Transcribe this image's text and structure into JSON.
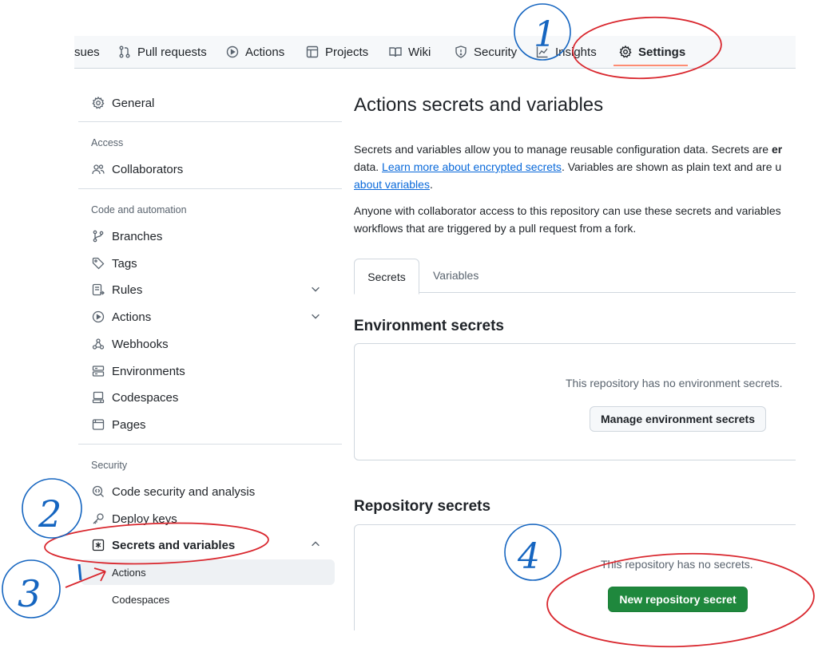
{
  "topnav": {
    "items": [
      {
        "label": "sues"
      },
      {
        "label": "Pull requests"
      },
      {
        "label": "Actions"
      },
      {
        "label": "Projects"
      },
      {
        "label": "Wiki"
      },
      {
        "label": "Security"
      },
      {
        "label": "Insights"
      },
      {
        "label": "Settings"
      }
    ]
  },
  "sidebar": {
    "general": "General",
    "access_heading": "Access",
    "collaborators": "Collaborators",
    "code_heading": "Code and automation",
    "branches": "Branches",
    "tags": "Tags",
    "rules": "Rules",
    "actions": "Actions",
    "webhooks": "Webhooks",
    "environments": "Environments",
    "codespaces": "Codespaces",
    "pages": "Pages",
    "security_heading": "Security",
    "code_security": "Code security and analysis",
    "deploy_keys": "Deploy keys",
    "secrets_vars": "Secrets and variables",
    "sub_actions": "Actions",
    "sub_codespaces": "Codespaces"
  },
  "main": {
    "title": "Actions secrets and variables",
    "desc1_a": "Secrets and variables allow you to manage reusable configuration data. Secrets are ",
    "desc1_b": "er",
    "desc2_a": "data. ",
    "desc2_link": "Learn more about encrypted secrets",
    "desc2_b": ". Variables are shown as plain text and are u",
    "desc3_link": "about variables",
    "desc3_b": ".",
    "desc4": "Anyone with collaborator access to this repository can use these secrets and variables",
    "desc5": "workflows that are triggered by a pull request from a fork.",
    "tabs": [
      {
        "label": "Secrets"
      },
      {
        "label": "Variables"
      }
    ],
    "env_heading": "Environment secrets",
    "env_empty": "This repository has no environment secrets.",
    "env_button": "Manage environment secrets",
    "repo_heading": "Repository secrets",
    "repo_empty": "This repository has no secrets.",
    "repo_button": "New repository secret"
  },
  "annotations": {
    "n1": "1",
    "n2": "2",
    "n3": "3",
    "n4": "4"
  },
  "colors": {
    "annotation_red": "#d9272e",
    "annotation_blue": "#1565c0",
    "primary_green": "#1f883d",
    "link_blue": "#0969da"
  }
}
